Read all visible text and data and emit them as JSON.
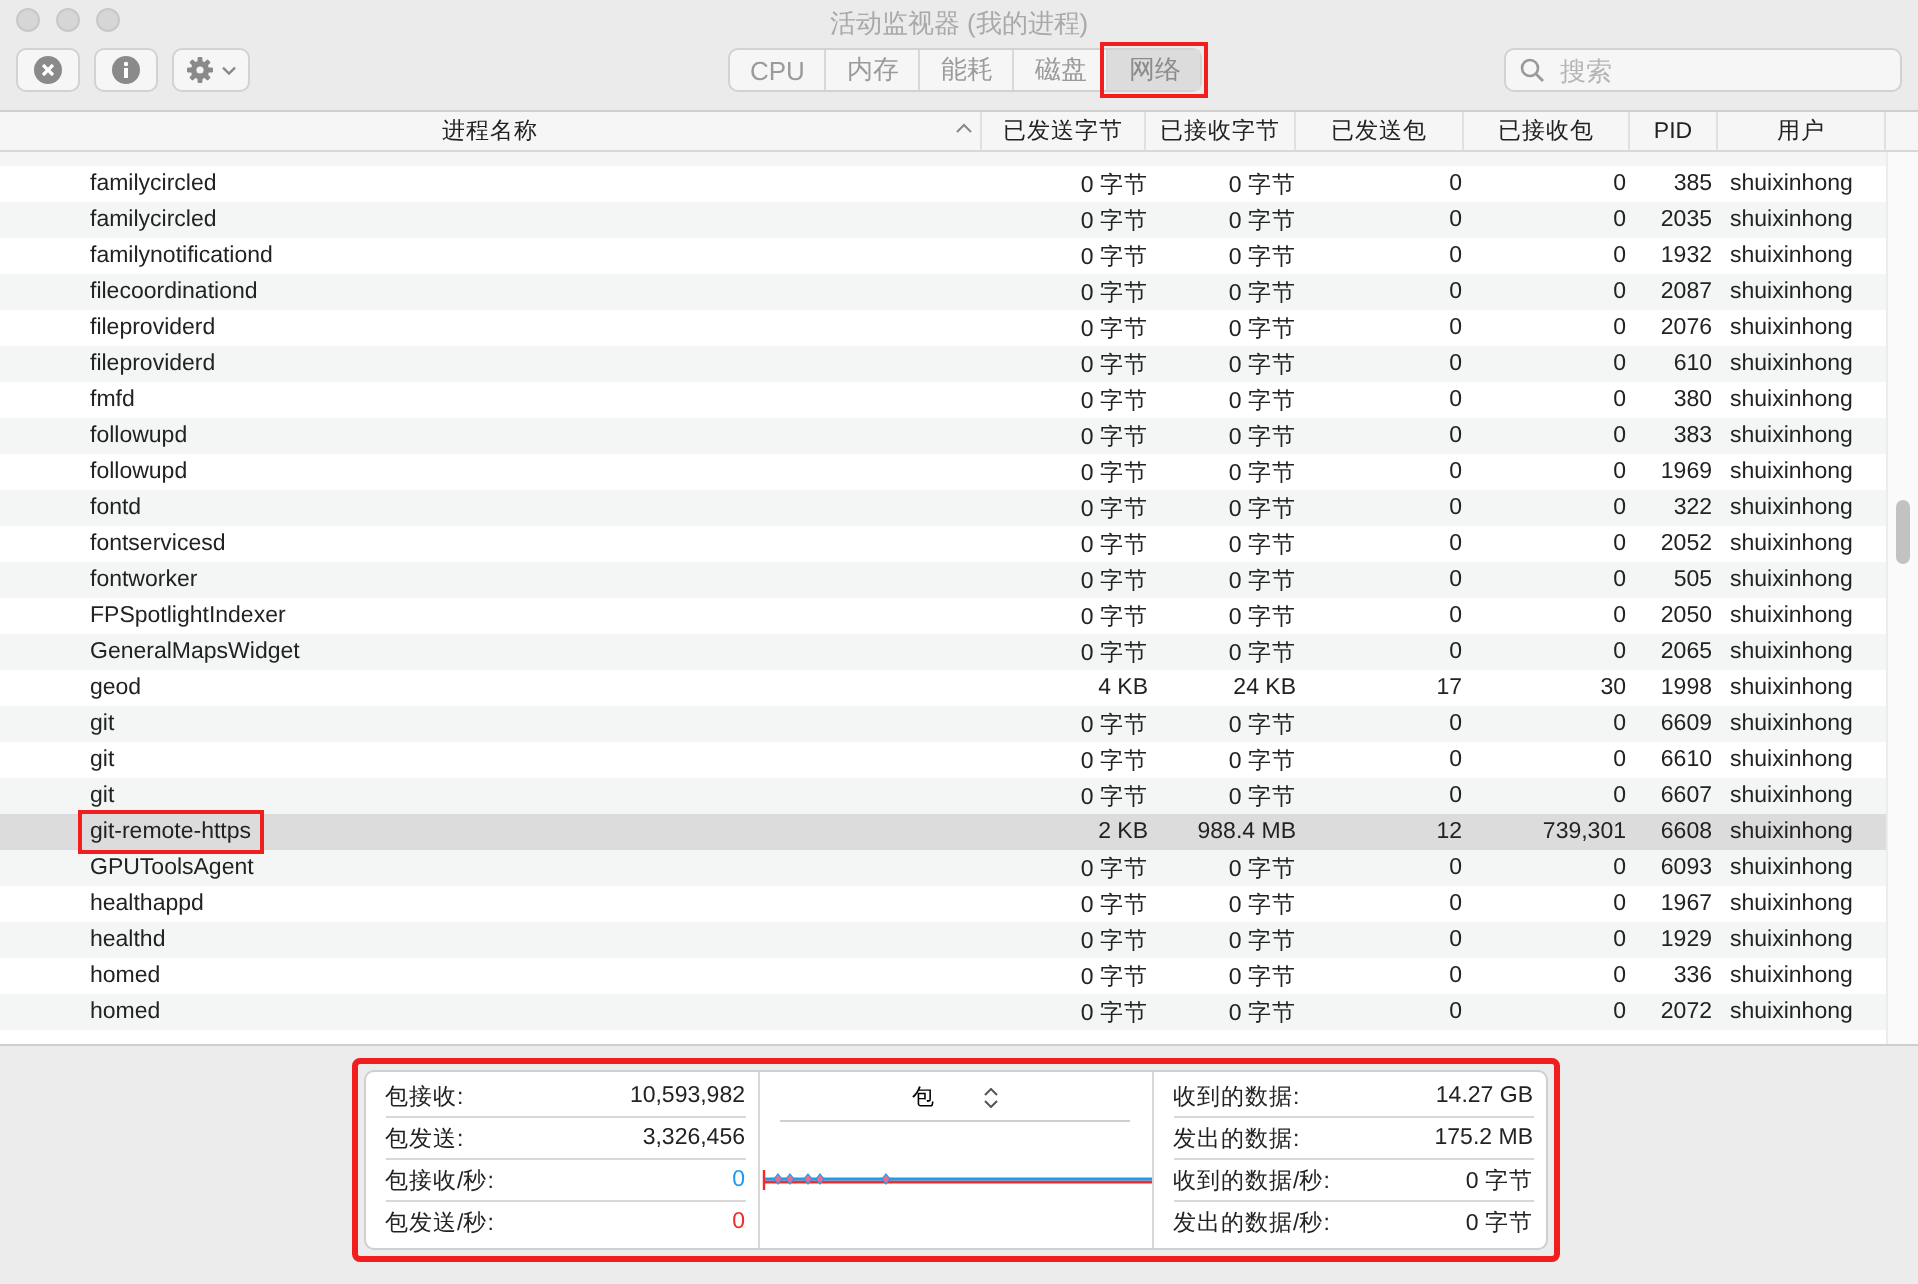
{
  "window": {
    "title": "活动监视器 (我的进程)"
  },
  "tabs": [
    {
      "label": "CPU",
      "selected": false,
      "highlighted": false
    },
    {
      "label": "内存",
      "selected": false,
      "highlighted": false
    },
    {
      "label": "能耗",
      "selected": false,
      "highlighted": false
    },
    {
      "label": "磁盘",
      "selected": false,
      "highlighted": false
    },
    {
      "label": "网络",
      "selected": true,
      "highlighted": true
    }
  ],
  "search": {
    "placeholder": "搜索"
  },
  "table": {
    "columns": [
      "进程名称",
      "已发送字节",
      "已接收字节",
      "已发送包",
      "已接收包",
      "PID",
      "用户"
    ],
    "rows": [
      {
        "cells": [
          "familycircled",
          "0 字节",
          "0 字节",
          "0",
          "0",
          "385",
          "shuixinhong"
        ],
        "selected": false,
        "highlighted": false
      },
      {
        "cells": [
          "familycircled",
          "0 字节",
          "0 字节",
          "0",
          "0",
          "2035",
          "shuixinhong"
        ],
        "selected": false,
        "highlighted": false
      },
      {
        "cells": [
          "familynotificationd",
          "0 字节",
          "0 字节",
          "0",
          "0",
          "1932",
          "shuixinhong"
        ],
        "selected": false,
        "highlighted": false
      },
      {
        "cells": [
          "filecoordinationd",
          "0 字节",
          "0 字节",
          "0",
          "0",
          "2087",
          "shuixinhong"
        ],
        "selected": false,
        "highlighted": false
      },
      {
        "cells": [
          "fileproviderd",
          "0 字节",
          "0 字节",
          "0",
          "0",
          "2076",
          "shuixinhong"
        ],
        "selected": false,
        "highlighted": false
      },
      {
        "cells": [
          "fileproviderd",
          "0 字节",
          "0 字节",
          "0",
          "0",
          "610",
          "shuixinhong"
        ],
        "selected": false,
        "highlighted": false
      },
      {
        "cells": [
          "fmfd",
          "0 字节",
          "0 字节",
          "0",
          "0",
          "380",
          "shuixinhong"
        ],
        "selected": false,
        "highlighted": false
      },
      {
        "cells": [
          "followupd",
          "0 字节",
          "0 字节",
          "0",
          "0",
          "383",
          "shuixinhong"
        ],
        "selected": false,
        "highlighted": false
      },
      {
        "cells": [
          "followupd",
          "0 字节",
          "0 字节",
          "0",
          "0",
          "1969",
          "shuixinhong"
        ],
        "selected": false,
        "highlighted": false
      },
      {
        "cells": [
          "fontd",
          "0 字节",
          "0 字节",
          "0",
          "0",
          "322",
          "shuixinhong"
        ],
        "selected": false,
        "highlighted": false
      },
      {
        "cells": [
          "fontservicesd",
          "0 字节",
          "0 字节",
          "0",
          "0",
          "2052",
          "shuixinhong"
        ],
        "selected": false,
        "highlighted": false
      },
      {
        "cells": [
          "fontworker",
          "0 字节",
          "0 字节",
          "0",
          "0",
          "505",
          "shuixinhong"
        ],
        "selected": false,
        "highlighted": false
      },
      {
        "cells": [
          "FPSpotlightIndexer",
          "0 字节",
          "0 字节",
          "0",
          "0",
          "2050",
          "shuixinhong"
        ],
        "selected": false,
        "highlighted": false
      },
      {
        "cells": [
          "GeneralMapsWidget",
          "0 字节",
          "0 字节",
          "0",
          "0",
          "2065",
          "shuixinhong"
        ],
        "selected": false,
        "highlighted": false
      },
      {
        "cells": [
          "geod",
          "4 KB",
          "24 KB",
          "17",
          "30",
          "1998",
          "shuixinhong"
        ],
        "selected": false,
        "highlighted": false
      },
      {
        "cells": [
          "git",
          "0 字节",
          "0 字节",
          "0",
          "0",
          "6609",
          "shuixinhong"
        ],
        "selected": false,
        "highlighted": false
      },
      {
        "cells": [
          "git",
          "0 字节",
          "0 字节",
          "0",
          "0",
          "6610",
          "shuixinhong"
        ],
        "selected": false,
        "highlighted": false
      },
      {
        "cells": [
          "git",
          "0 字节",
          "0 字节",
          "0",
          "0",
          "6607",
          "shuixinhong"
        ],
        "selected": false,
        "highlighted": false
      },
      {
        "cells": [
          "git-remote-https",
          "2 KB",
          "988.4 MB",
          "12",
          "739,301",
          "6608",
          "shuixinhong"
        ],
        "selected": true,
        "highlighted": true
      },
      {
        "cells": [
          "GPUToolsAgent",
          "0 字节",
          "0 字节",
          "0",
          "0",
          "6093",
          "shuixinhong"
        ],
        "selected": false,
        "highlighted": false
      },
      {
        "cells": [
          "healthappd",
          "0 字节",
          "0 字节",
          "0",
          "0",
          "1967",
          "shuixinhong"
        ],
        "selected": false,
        "highlighted": false
      },
      {
        "cells": [
          "healthd",
          "0 字节",
          "0 字节",
          "0",
          "0",
          "1929",
          "shuixinhong"
        ],
        "selected": false,
        "highlighted": false
      },
      {
        "cells": [
          "homed",
          "0 字节",
          "0 字节",
          "0",
          "0",
          "336",
          "shuixinhong"
        ],
        "selected": false,
        "highlighted": false
      },
      {
        "cells": [
          "homed",
          "0 字节",
          "0 字节",
          "0",
          "0",
          "2072",
          "shuixinhong"
        ],
        "selected": false,
        "highlighted": false
      }
    ]
  },
  "summary": {
    "highlighted": true,
    "packets": [
      {
        "label": "包接收:",
        "value": "10,593,982",
        "color": "#222222"
      },
      {
        "label": "包发送:",
        "value": "3,326,456",
        "color": "#222222"
      },
      {
        "label": "包接收/秒:",
        "value": "0",
        "color": "#1e9bf0"
      },
      {
        "label": "包发送/秒:",
        "value": "0",
        "color": "#f02d2d"
      }
    ],
    "chart_selector": "包",
    "data": [
      {
        "label": "收到的数据:",
        "value": "14.27 GB"
      },
      {
        "label": "发出的数据:",
        "value": "175.2 MB"
      },
      {
        "label": "收到的数据/秒:",
        "value": "0 字节"
      },
      {
        "label": "发出的数据/秒:",
        "value": "0 字节"
      }
    ]
  }
}
